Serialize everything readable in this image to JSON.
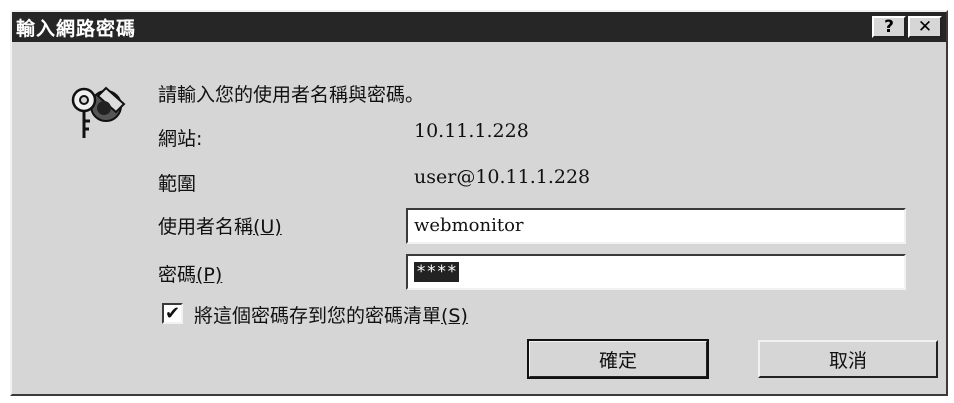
{
  "window": {
    "title": "輸入網路密碼",
    "help_label": "?",
    "close_label": "✕"
  },
  "prompt": "請輸入您的使用者名稱與密碼。",
  "site": {
    "label": "網站:",
    "value": "10.11.1.228"
  },
  "realm": {
    "label": "範圍",
    "value": "user@10.11.1.228"
  },
  "username": {
    "label": "使用者名稱",
    "accesskey": "(U)",
    "value": "webmonitor"
  },
  "password": {
    "label": "密碼",
    "accesskey": "(P)",
    "value": "****"
  },
  "save_password": {
    "label": "將這個密碼存到您的密碼清單",
    "accesskey": "(S)",
    "checked": true,
    "check_glyph": "✔"
  },
  "buttons": {
    "ok": "確定",
    "cancel": "取消"
  },
  "icons": {
    "key_lock": "key-lock-icon"
  }
}
